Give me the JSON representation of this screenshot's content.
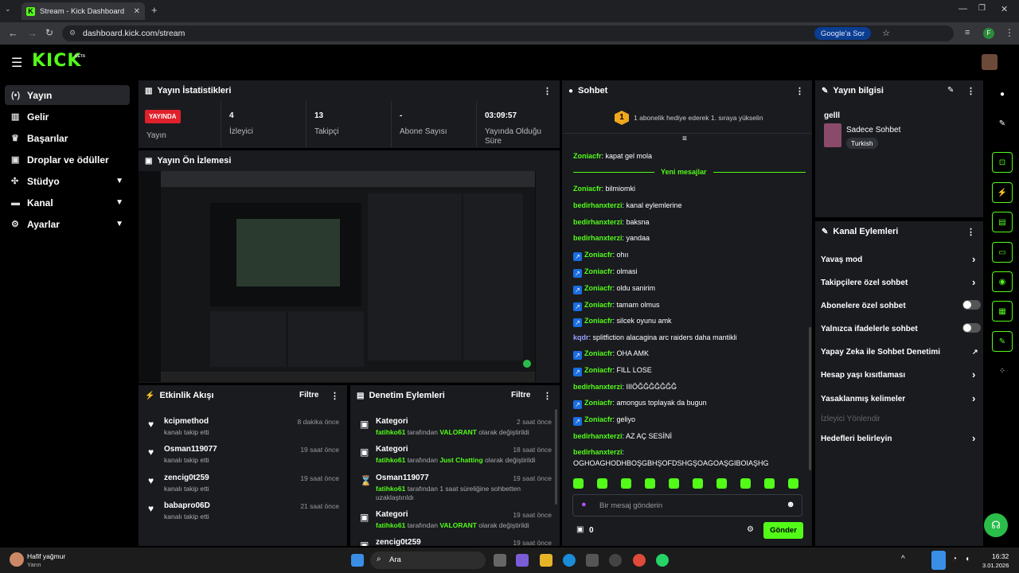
{
  "browser": {
    "tab_title": "Stream - Kick Dashboard",
    "url": "dashboard.kick.com/stream",
    "google_chip": "Google'a Sor",
    "profile": "F"
  },
  "site": {
    "logo": "KICK",
    "beta": "BETA"
  },
  "sidebar": {
    "items": [
      {
        "label": "Yayın",
        "icon": "live-icon"
      },
      {
        "label": "Gelir",
        "icon": "chart-icon"
      },
      {
        "label": "Başarılar",
        "icon": "trophy-icon"
      },
      {
        "label": "Droplar ve ödüller",
        "icon": "gift-icon"
      },
      {
        "label": "Stüdyo",
        "icon": "studio-icon"
      },
      {
        "label": "Kanal",
        "icon": "channel-icon"
      },
      {
        "label": "Ayarlar",
        "icon": "gear-icon"
      }
    ]
  },
  "stats": {
    "title": "Yayın İstatistikleri",
    "live_badge": "YAYINDA",
    "live_label": "Yayın",
    "viewers_value": "4",
    "viewers_label": "İzleyici",
    "followers_value": "13",
    "followers_label": "Takipçi",
    "subs_value": "-",
    "subs_label": "Abone Sayısı",
    "time_value": "03:09:57",
    "time_label": "Yayında Olduğu Süre"
  },
  "preview": {
    "title": "Yayın Ön İzlemesi"
  },
  "activity": {
    "title": "Etkinlik Akışı",
    "filter": "Filtre",
    "rows": [
      {
        "name": "kcipmethod",
        "desc": "kanalı takip etti",
        "time": "8 dakika önce"
      },
      {
        "name": "Osman119077",
        "desc": "kanalı takip etti",
        "time": "19 saat önce"
      },
      {
        "name": "zencig0t259",
        "desc": "kanalı takip etti",
        "time": "19 saat önce"
      },
      {
        "name": "babapro06D",
        "desc": "kanalı takip etti",
        "time": "21 saat önce"
      }
    ]
  },
  "moderation": {
    "title": "Denetim Eylemleri",
    "filter": "Filtre",
    "rows": [
      {
        "name": "Kategori",
        "actor": "fatihko61",
        "pre": " tarafından ",
        "hl": "VALORANT",
        "post": " olarak değiştirildi",
        "time": "2 saat önce"
      },
      {
        "name": "Kategori",
        "actor": "fatihko61",
        "pre": " tarafından ",
        "hl": "Just Chatting",
        "post": " olarak değiştirildi",
        "time": "18 saat önce"
      },
      {
        "name": "Osman119077",
        "actor": "fatihko61",
        "pre": " tarafından 1 saat süreliğine sohbetten",
        "hl": "",
        "post": "",
        "extra": "uzaklaştırıldı",
        "time": "19 saat önce"
      },
      {
        "name": "Kategori",
        "actor": "fatihko61",
        "pre": " tarafından ",
        "hl": "VALORANT",
        "post": " olarak değiştirildi",
        "time": "19 saat önce"
      },
      {
        "name": "zencig0t259",
        "actor": "",
        "pre": "",
        "hl": "",
        "post": "",
        "time": "19 saat önce"
      }
    ]
  },
  "chat": {
    "title": "Sohbet",
    "goal_num": "1",
    "goal_text": "1 abonelik hediye ederek 1. sıraya yükselin",
    "new_messages": "Yeni mesajlar",
    "placeholder": "Bir mesaj gönderin",
    "send": "Gönder",
    "count": "0",
    "messages": [
      {
        "user": "Zoniacfr",
        "text": "kapat gel mola",
        "style": "green",
        "badge": false
      },
      {
        "user": "Zoniacfr",
        "text": "bilmiomki",
        "style": "green",
        "badge": false
      },
      {
        "user": "bedirhanxterzi",
        "text": "kanal eylemlerine",
        "style": "green",
        "badge": false
      },
      {
        "user": "bedirhanxterzi",
        "text": "baksna",
        "style": "green",
        "badge": false
      },
      {
        "user": "bedirhanxterzi",
        "text": "yandaa",
        "style": "green",
        "badge": false
      },
      {
        "user": "Zoniacfr",
        "text": "ohıı",
        "style": "green",
        "badge": true
      },
      {
        "user": "Zoniacfr",
        "text": "olmasi",
        "style": "green",
        "badge": true
      },
      {
        "user": "Zoniacfr",
        "text": "oldu sanirim",
        "style": "green",
        "badge": true
      },
      {
        "user": "Zoniacfr",
        "text": "tamam olmus",
        "style": "green",
        "badge": true
      },
      {
        "user": "Zoniacfr",
        "text": "silcek oyunu amk",
        "style": "green",
        "badge": true
      },
      {
        "user": "kqdr",
        "text": "splitfiction alacagina arc raiders daha mantikli",
        "style": "purple",
        "badge": false
      },
      {
        "user": "Zoniacfr",
        "text": "OHA AMK",
        "style": "green",
        "badge": true
      },
      {
        "user": "Zoniacfr",
        "text": "FILL LOSE",
        "style": "green",
        "badge": true
      },
      {
        "user": "bedirhanxterzi",
        "text": "IIIÖĞĞĞĞĞĞĞ",
        "style": "green",
        "badge": false
      },
      {
        "user": "Zoniacfr",
        "text": "amongus toplayak da bugun",
        "style": "green",
        "badge": true
      },
      {
        "user": "Zoniacfr",
        "text": "geliyo",
        "style": "green",
        "badge": true
      },
      {
        "user": "bedirhanxterzi",
        "text": "AZ AÇ SESİNİ",
        "style": "green",
        "badge": false
      }
    ],
    "last_user": "bedirhanxterzi",
    "last_text": "OGHOAGHODHBOŞGBHŞOFDSHGŞOAGOAŞGIBOIAŞHG"
  },
  "info": {
    "title": "Yayın bilgisi",
    "stream_title": "gelll",
    "category": "Sadece Sohbet",
    "tag": "Turkish"
  },
  "channel_actions": {
    "title": "Kanal Eylemleri",
    "items": [
      {
        "label": "Yavaş mod",
        "kind": "chevron"
      },
      {
        "label": "Takipçilere özel sohbet",
        "kind": "chevron"
      },
      {
        "label": "Abonelere özel sohbet",
        "kind": "toggle"
      },
      {
        "label": "Yalnızca ifadelerle sohbet",
        "kind": "toggle"
      },
      {
        "label": "Yapay Zeka ile Sohbet Denetimi",
        "kind": "external"
      },
      {
        "label": "Hesap yaşı kısıtlaması",
        "kind": "chevron"
      },
      {
        "label": "Yasaklanmış kelimeler",
        "kind": "chevron"
      },
      {
        "label": "İzleyici Yönlendir",
        "kind": "disabled"
      },
      {
        "label": "Hedefleri belirleyin",
        "kind": "chevron"
      }
    ]
  },
  "taskbar": {
    "weather": "Hafif yağmur",
    "weather_sub": "Yarın",
    "search": "Ara",
    "time": "16:32",
    "date": "3.01.2026"
  },
  "colors": {
    "accent": "#53fc18",
    "panel": "#191b1f",
    "live": "#e0202a"
  }
}
